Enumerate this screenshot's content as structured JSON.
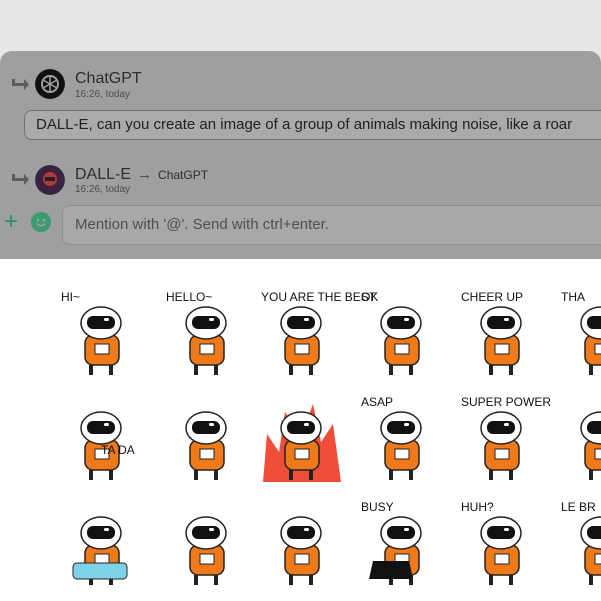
{
  "messages": [
    {
      "sender": "ChatGPT",
      "time": "16:26, today",
      "text": "DALL-E, can you create an image of a group of animals making noise, like a roar"
    },
    {
      "sender": "DALL-E",
      "arrow": "→",
      "target": "ChatGPT",
      "time": "16:26, today"
    }
  ],
  "composer": {
    "placeholder": "Mention with '@'. Send with ctrl+enter."
  },
  "stickers": [
    {
      "caption": "HI~",
      "icon": "astronaut-waving-icon"
    },
    {
      "caption": "HELLO~",
      "icon": "astronaut-hello-icon"
    },
    {
      "caption": "YOU ARE THE BEST",
      "icon": "astronaut-thumbs-up-icon"
    },
    {
      "caption": "OK",
      "icon": "astronaut-ok-icon"
    },
    {
      "caption": "CHEER UP",
      "icon": "astronaut-cheer-icon"
    },
    {
      "caption": "THA",
      "icon": "astronaut-thanks-icon"
    },
    {
      "caption": "TA DA",
      "icon": "astronaut-tada-icon"
    },
    {
      "caption": "",
      "icon": "astronaut-salute-icon"
    },
    {
      "caption": "",
      "icon": "astronaut-fire-icon"
    },
    {
      "caption": "ASAP",
      "icon": "astronaut-running-icon"
    },
    {
      "caption": "SUPER POWER",
      "icon": "astronaut-super-power-icon"
    },
    {
      "caption": "",
      "icon": "astronaut-peek-icon"
    },
    {
      "caption": "",
      "icon": "astronaut-birthday-icon"
    },
    {
      "caption": "",
      "icon": "astronaut-stop-icon"
    },
    {
      "caption": "",
      "icon": "astronaut-fishing-icon"
    },
    {
      "caption": "BUSY",
      "icon": "astronaut-busy-icon"
    },
    {
      "caption": "HUH?",
      "icon": "astronaut-huh-icon"
    },
    {
      "caption": "LE BR",
      "icon": "astronaut-tea-icon"
    }
  ]
}
